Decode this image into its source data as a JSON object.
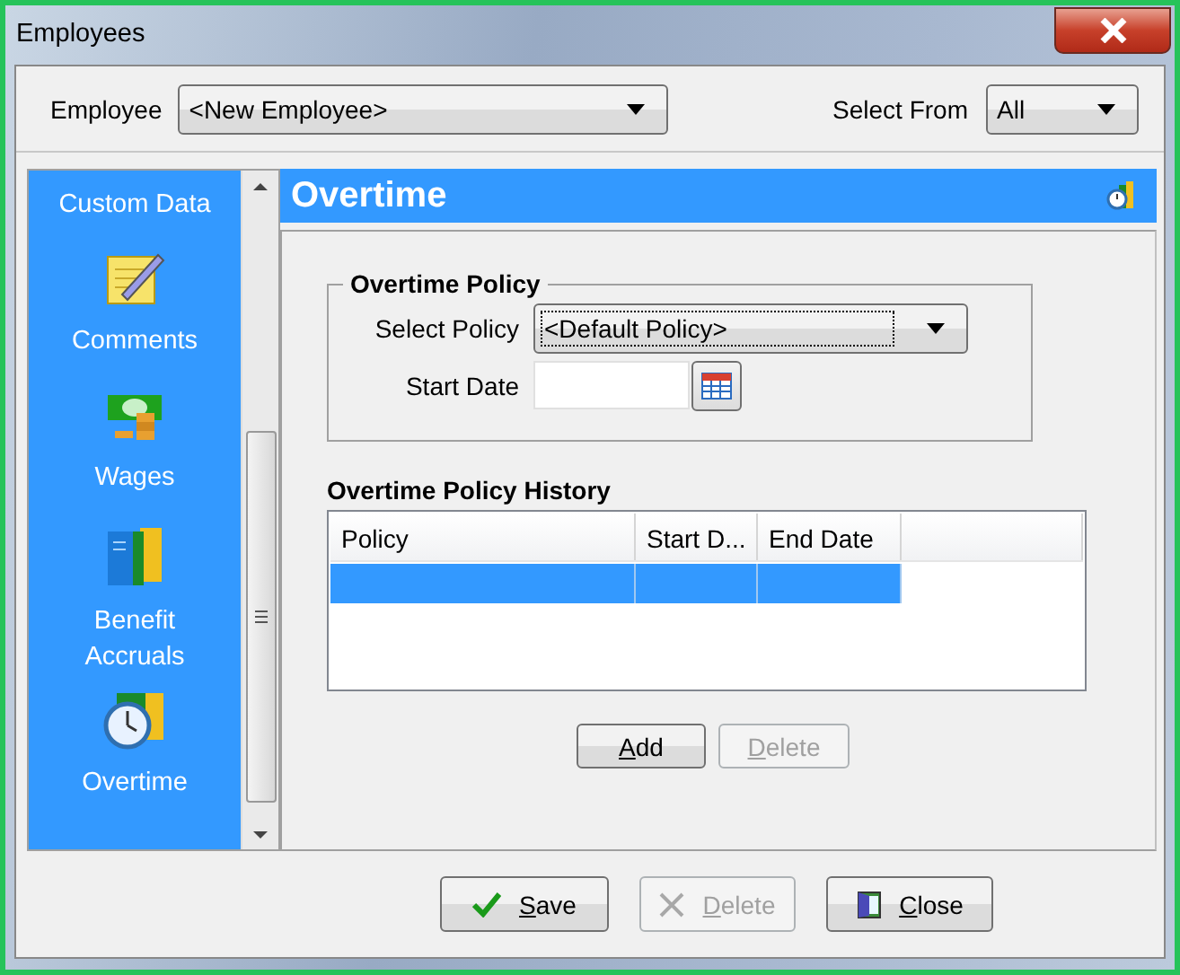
{
  "window": {
    "title": "Employees"
  },
  "employee": {
    "label": "Employee",
    "value": "<New Employee>"
  },
  "select_from": {
    "label": "Select From",
    "value": "All"
  },
  "sidebar": {
    "items": [
      {
        "label": "Custom Data"
      },
      {
        "label": "Comments"
      },
      {
        "label": "Wages"
      },
      {
        "label": "Benefit Accruals"
      },
      {
        "label": "Overtime"
      }
    ]
  },
  "panel": {
    "title": "Overtime"
  },
  "overtime_policy": {
    "title": "Overtime Policy",
    "select_policy": {
      "label": "Select Policy",
      "value": "<Default Policy>"
    },
    "start_date": {
      "label": "Start Date"
    }
  },
  "history": {
    "title": "Overtime Policy History",
    "columns": [
      "Policy",
      "Start D...",
      "End Date"
    ],
    "rows": [
      {
        "selected": true
      }
    ],
    "buttons": [
      {
        "label": "Add",
        "disabled": false
      },
      {
        "label": "Delete",
        "disabled": true
      }
    ]
  },
  "footer_buttons": [
    {
      "label": "Save",
      "disabled": false
    },
    {
      "label": "Delete",
      "disabled": true
    },
    {
      "label": "Close",
      "disabled": false
    }
  ]
}
